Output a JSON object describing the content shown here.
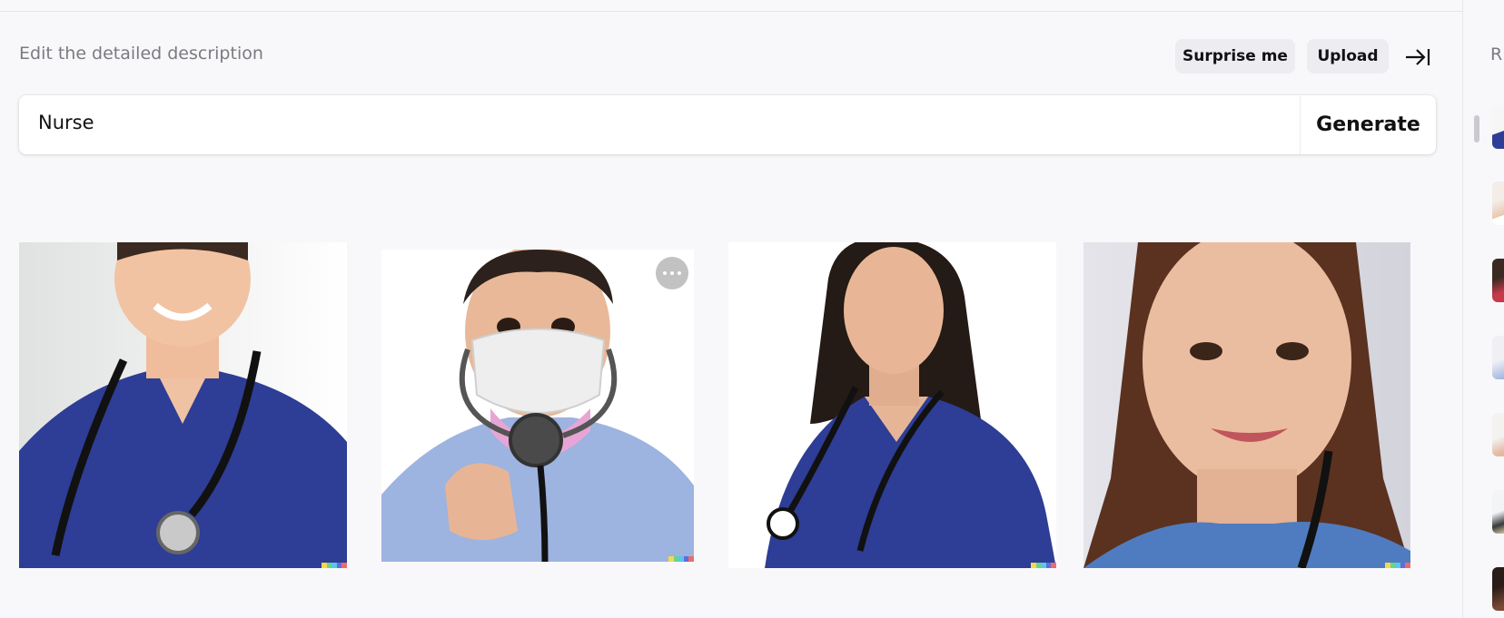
{
  "header": {
    "description_label": "Edit the detailed description",
    "surprise_label": "Surprise me",
    "upload_label": "Upload"
  },
  "prompt": {
    "value": "Nurse",
    "generate_label": "Generate"
  },
  "results": [
    {
      "subject": "male nurse smiling in navy scrubs with stethoscope"
    },
    {
      "subject": "nurse wearing face mask holding stethoscope"
    },
    {
      "subject": "female nurse in navy scrubs with stethoscope"
    },
    {
      "subject": "female nurse close-up portrait in blue scrubs"
    }
  ],
  "sidebar": {
    "title_partial": "R"
  },
  "colors": {
    "scrub_navy": "#2e3d95",
    "scrub_light": "#9db3e0",
    "signature": [
      "#f5d94a",
      "#67d58a",
      "#5cc5e8",
      "#5b6ee1",
      "#ef6b6b"
    ]
  }
}
